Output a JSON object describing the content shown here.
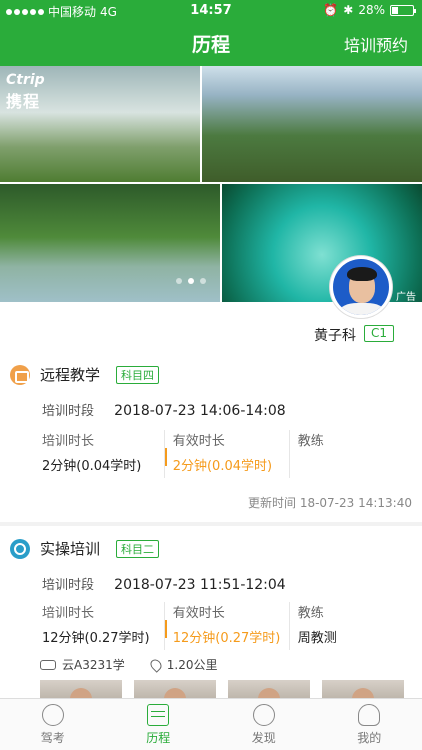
{
  "status": {
    "carrier": "中国移动",
    "network": "4G",
    "time": "14:57",
    "battery": "28%"
  },
  "header": {
    "title": "历程",
    "right_action": "培训预约"
  },
  "banner": {
    "logo_en": "Ctrip",
    "logo_cn": "携程",
    "ad_label": "广告"
  },
  "profile": {
    "name": "黄子科",
    "license_class": "C1"
  },
  "records": [
    {
      "title": "远程教学",
      "subject": "科目四",
      "period_label": "培训时段",
      "period": "2018-07-23 14:06-14:08",
      "duration_label": "培训时长",
      "duration": "2分钟(0.04学时)",
      "effective_label": "有效时长",
      "effective": "2分钟(0.04学时)",
      "coach_label": "教练",
      "coach": "",
      "update": "更新时间 18-07-23 14:13:40"
    },
    {
      "title": "实操培训",
      "subject": "科目二",
      "period_label": "培训时段",
      "period": "2018-07-23 11:51-12:04",
      "duration_label": "培训时长",
      "duration": "12分钟(0.27学时)",
      "effective_label": "有效时长",
      "effective": "12分钟(0.27学时)",
      "coach_label": "教练",
      "coach": "周教测",
      "car": "云A3231学",
      "distance": "1.20公里"
    }
  ],
  "tabs": [
    {
      "label": "驾考",
      "icon": "steering-wheel-icon"
    },
    {
      "label": "历程",
      "icon": "calendar-icon"
    },
    {
      "label": "发现",
      "icon": "moon-icon"
    },
    {
      "label": "我的",
      "icon": "user-icon"
    }
  ],
  "colors": {
    "brand_green": "#2aac3a",
    "accent_orange": "#f59b1c"
  }
}
